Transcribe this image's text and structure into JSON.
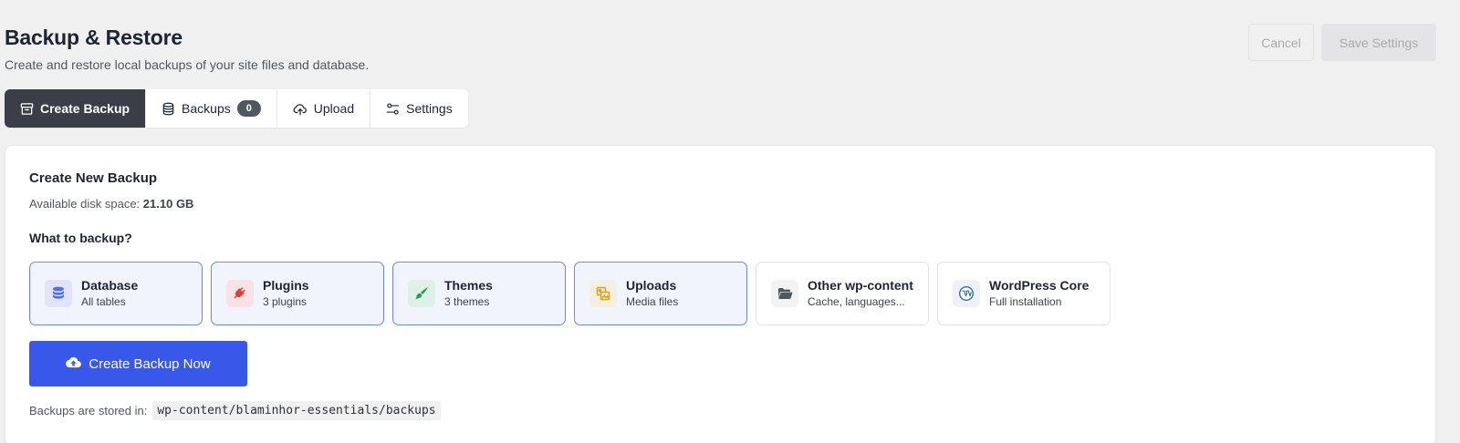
{
  "header": {
    "title": "Backup & Restore",
    "subtitle": "Create and restore local backups of your site files and database.",
    "cancel_label": "Cancel",
    "save_label": "Save Settings"
  },
  "tabs": [
    {
      "label": "Create Backup",
      "icon": "archive-icon",
      "active": true
    },
    {
      "label": "Backups",
      "icon": "database-icon",
      "badge": "0"
    },
    {
      "label": "Upload",
      "icon": "cloud-upload-icon"
    },
    {
      "label": "Settings",
      "icon": "sliders-icon"
    }
  ],
  "create": {
    "title": "Create New Backup",
    "disk_label": "Available disk space:",
    "disk_value": "21.10 GB",
    "what_label": "What to backup?",
    "options": [
      {
        "title": "Database",
        "sub": "All tables",
        "icon": "database-icon",
        "selected": true,
        "color": "#4f6ef7",
        "bg": "#dfe4fb"
      },
      {
        "title": "Plugins",
        "sub": "3 plugins",
        "icon": "plug-icon",
        "selected": true,
        "color": "#e0403a",
        "bg": "#f8e2e6"
      },
      {
        "title": "Themes",
        "sub": "3 themes",
        "icon": "paint-brush-icon",
        "selected": true,
        "color": "#1f9d55",
        "bg": "#dff1e7"
      },
      {
        "title": "Uploads",
        "sub": "Media files",
        "icon": "images-icon",
        "selected": true,
        "color": "#d9a21b",
        "bg": "#f5efdf"
      },
      {
        "title": "Other wp-content",
        "sub": "Cache, languages...",
        "icon": "folder-open-icon",
        "selected": false,
        "color": "#50575e",
        "bg": "#f3f3f4"
      },
      {
        "title": "WordPress Core",
        "sub": "Full installation",
        "icon": "wordpress-icon",
        "selected": false,
        "color": "#2f6fb5",
        "bg": "#eef2f8"
      }
    ],
    "button_label": "Create Backup Now",
    "stored_label": "Backups are stored in:",
    "stored_path": "wp-content/blaminhor-essentials/backups"
  },
  "colors": {
    "accent": "#3858e9",
    "tab_active_bg": "#3a3f47",
    "selected_border": "#6d87e6"
  }
}
